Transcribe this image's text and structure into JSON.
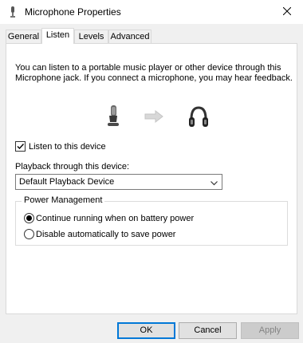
{
  "window": {
    "title": "Microphone Properties"
  },
  "tabs": [
    {
      "label": "General",
      "active": false
    },
    {
      "label": "Listen",
      "active": true
    },
    {
      "label": "Levels",
      "active": false
    },
    {
      "label": "Advanced",
      "active": false
    }
  ],
  "listen": {
    "description": "You can listen to a portable music player or other device through this Microphone jack.  If you connect a microphone, you may hear feedback.",
    "icons": [
      "microphone-icon",
      "arrow-right-icon",
      "headphones-icon"
    ],
    "listen_checkbox": {
      "label": "Listen to this device",
      "checked": true
    },
    "playback_label": "Playback through this device:",
    "playback_device": {
      "selected": "Default Playback Device"
    },
    "power_management": {
      "title": "Power Management",
      "options": [
        {
          "label": "Continue running when on battery power",
          "selected": true
        },
        {
          "label": "Disable automatically to save power",
          "selected": false
        }
      ]
    }
  },
  "buttons": {
    "ok": "OK",
    "cancel": "Cancel",
    "apply": "Apply"
  },
  "colors": {
    "accent": "#0078d7",
    "panel_bg": "#ffffff",
    "dialog_bg": "#f0f0f0"
  }
}
